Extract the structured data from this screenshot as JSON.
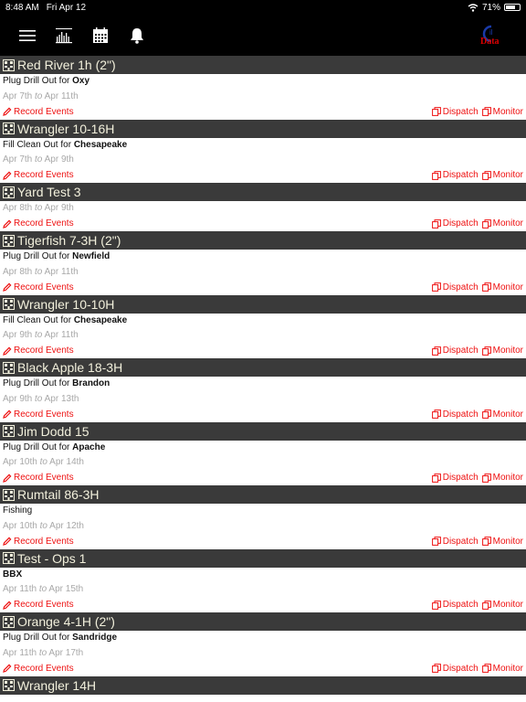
{
  "status": {
    "time": "8:48 AM",
    "date": "Fri Apr 12",
    "battery": "71%",
    "battery_level": 0.71
  },
  "toolbar": {
    "logo_top": "il",
    "logo_bottom": "Data"
  },
  "actions": {
    "record": "Record Events",
    "dispatch": "Dispatch",
    "monitor": "Monitor"
  },
  "jobs": [
    {
      "title": "Red River 1h (2\")",
      "desc": "Plug Drill Out for ",
      "company": "Oxy",
      "start": "Apr 7th",
      "to": "to",
      "end": "Apr 11th"
    },
    {
      "title": "Wrangler 10-16H",
      "desc": "Fill Clean Out for ",
      "company": "Chesapeake",
      "start": "Apr 7th",
      "to": "to",
      "end": "Apr 9th"
    },
    {
      "title": "Yard Test 3",
      "desc": "",
      "company": "",
      "start": "Apr 8th",
      "to": "to",
      "end": "Apr 9th"
    },
    {
      "title": "Tigerfish 7-3H (2\")",
      "desc": "Plug Drill Out for ",
      "company": "Newfield",
      "start": "Apr 8th",
      "to": "to",
      "end": "Apr 11th"
    },
    {
      "title": "Wrangler 10-10H",
      "desc": "Fill Clean Out for ",
      "company": "Chesapeake",
      "start": "Apr 9th",
      "to": "to",
      "end": "Apr 11th"
    },
    {
      "title": "Black Apple 18-3H",
      "desc": "Plug Drill Out for ",
      "company": "Brandon",
      "start": "Apr 9th",
      "to": "to",
      "end": "Apr 13th"
    },
    {
      "title": "Jim Dodd 15",
      "desc": "Plug Drill Out for ",
      "company": "Apache",
      "start": "Apr 10th",
      "to": "to",
      "end": "Apr 14th"
    },
    {
      "title": "Rumtail 86-3H",
      "desc": "Fishing",
      "company": "",
      "start": "Apr 10th",
      "to": "to",
      "end": "Apr 12th"
    },
    {
      "title": "Test - Ops 1",
      "desc": "",
      "company": "BBX",
      "start": "Apr 11th",
      "to": "to",
      "end": "Apr 15th"
    },
    {
      "title": "Orange 4-1H (2\")",
      "desc": "Plug Drill Out for ",
      "company": "Sandridge",
      "start": "Apr 11th",
      "to": "to",
      "end": "Apr 17th"
    },
    {
      "title": "Wrangler 14H",
      "desc": "",
      "company": "",
      "start": "",
      "to": "",
      "end": ""
    }
  ]
}
